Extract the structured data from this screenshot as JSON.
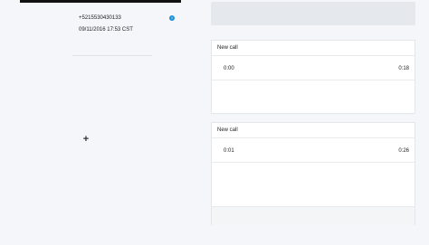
{
  "contact": {
    "phone": "+5215530430133",
    "timestamp": "09/11/2016 17:53 CST",
    "info_icon": "info-icon"
  },
  "actions": {
    "add_icon": "plus-icon",
    "add_glyph": "+"
  },
  "calls": [
    {
      "title": "New call",
      "time_start": "0:00",
      "time_end": "0:18"
    },
    {
      "title": "New call",
      "time_start": "0:01",
      "time_end": "0:26"
    }
  ]
}
